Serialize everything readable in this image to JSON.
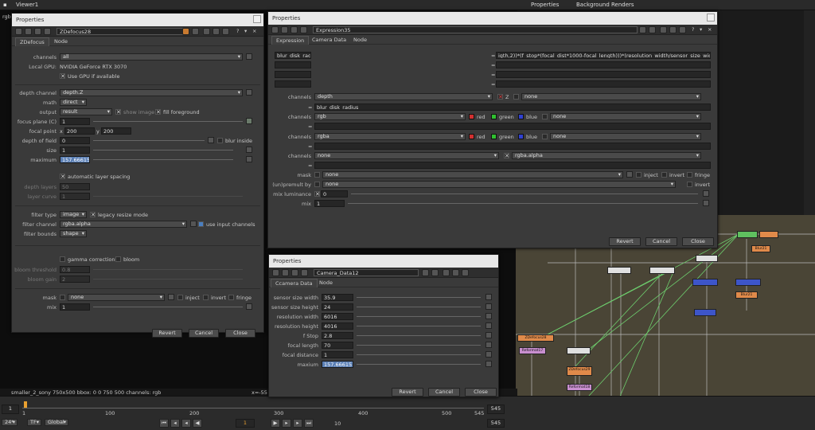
{
  "top": {
    "viewer_tab": "Viewer1",
    "properties_tab": "Properties",
    "bg_tab": "Background Renders",
    "rgb": "rgb"
  },
  "zd": {
    "title": "Properties",
    "node": "ZDefocus28",
    "tabs": [
      "ZDefocus",
      "Node"
    ],
    "channels_l": "channels",
    "channels_v": "all",
    "gpu_l": "Local GPU:",
    "gpu_v": "NVIDIA GeForce RTX 3070",
    "usegpu": "Use GPU if available",
    "depth_l": "depth channel",
    "depth_v": "depth.Z",
    "math_l": "math",
    "math_v": "direct",
    "output_l": "output",
    "output_v": "result",
    "show_image": "show image",
    "fill_fg": "fill foreground",
    "focus_l": "focus plane (C)",
    "focus_v": "1",
    "fpoint_l": "focal point",
    "fx": "200",
    "fy": "200",
    "dof_l": "depth of field",
    "dof_v": "0",
    "blur_inside": "blur inside",
    "size_l": "size",
    "size_v": "1",
    "max_l": "maximum",
    "max_v": "157.666157",
    "auto_layer": "automatic layer spacing",
    "dlayers_l": "depth layers",
    "dlayers_v": "50",
    "lcurve_l": "layer curve",
    "lcurve_v": "1",
    "ftype_l": "filter type",
    "ftype_v": "image",
    "legacy": "legacy resize mode",
    "fchan_l": "filter channel",
    "fchan_v": "rgba.alpha",
    "use_input": "use input channels",
    "fbounds_l": "filter bounds",
    "fbounds_v": "shape",
    "gamma": "gamma correction",
    "bloom": "bloom",
    "bthresh_l": "bloom threshold",
    "bthresh_v": "0.8",
    "bgain_l": "bloom gain",
    "bgain_v": "2",
    "mask_l": "mask",
    "mask_v": "none",
    "inject": "inject",
    "invert": "invert",
    "fringe": "fringe",
    "mix_l": "mix",
    "mix_v": "1",
    "btns": [
      "Revert",
      "Cancel",
      "Close"
    ]
  },
  "ex": {
    "title": "Properties",
    "node": "Expression35",
    "tabs": [
      "Expression",
      "Camera Data",
      "Node"
    ],
    "name1": "blur_disk_radiu",
    "expr1": "igth,2))*(f_stop*(focal_dist*1000-focal_length)))*(resolution_width/sensor_size_width)/2",
    "eq": "=",
    "ch_l": "channels",
    "c1": "depth",
    "z": "Z",
    "none": "none",
    "name2": "blur_disk_radius",
    "c2": "rgb",
    "red": "red",
    "green": "green",
    "blue": "blue",
    "c3": "rgba",
    "c4": "none",
    "alpha": "rgba.alpha",
    "mask_l": "mask",
    "inject": "inject",
    "invert": "invert",
    "fringe": "fringe",
    "unp_l": "(un)premult by",
    "mixlum_l": "mix luminance",
    "mixlum_v": "0",
    "mix_l": "mix",
    "mix_v": "1",
    "btns": [
      "Revert",
      "Cancel",
      "Close"
    ]
  },
  "cd": {
    "title": "Properties",
    "node": "Camera_Data12",
    "tabs": [
      "Ccamera Data",
      "Node"
    ],
    "rows": [
      {
        "l": "sensor size width",
        "v": "35.9"
      },
      {
        "l": "sensor size height",
        "v": "24"
      },
      {
        "l": "resolution width",
        "v": "6016"
      },
      {
        "l": "resolution height",
        "v": "4016"
      },
      {
        "l": "f Stop",
        "v": "2.8"
      },
      {
        "l": "focal length",
        "v": "70"
      },
      {
        "l": "focal distance",
        "v": "1"
      },
      {
        "l": "maxium",
        "v": "157.666157"
      }
    ],
    "btns": [
      "Revert",
      "Cancel",
      "Close"
    ]
  },
  "status": {
    "info": "smaller_2_sony 750x500  bbox: 0 0 750 500 channels: rgb",
    "coord": "x=-55"
  },
  "timeline": {
    "ticks": [
      "1",
      "100",
      "200",
      "300",
      "400",
      "500",
      "545"
    ],
    "start": "1",
    "end": "545",
    "fps": "24*",
    "tf": "TF",
    "global": "Global",
    "frame": "1",
    "step": "10",
    "end2": "545"
  },
  "dag": {
    "nodes": [
      "ZDefocus28",
      "Reformat17",
      "ZDefocus29",
      "Reformat18",
      "ZDefocus28 (result)",
      "Blur21",
      "Blur21"
    ]
  }
}
